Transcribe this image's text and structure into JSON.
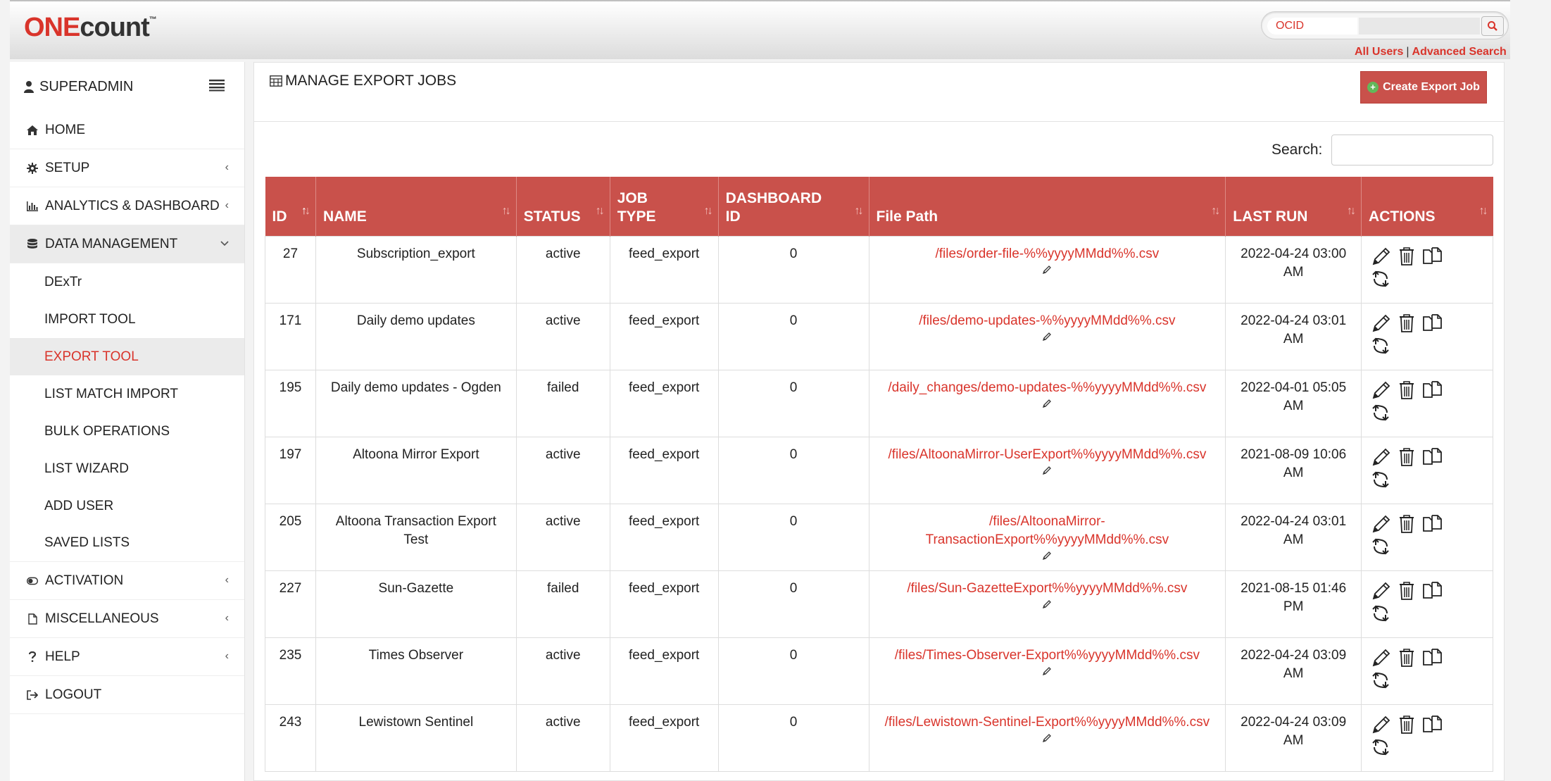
{
  "header": {
    "logo_one": "ONE",
    "logo_count": "count",
    "logo_tm": "™",
    "search_prefix": "OCID",
    "links": {
      "all_users": "All Users",
      "separator": "|",
      "advanced_search": "Advanced Search"
    }
  },
  "sidebar": {
    "user": "SUPERADMIN",
    "items": [
      {
        "label": "HOME",
        "icon": "home-icon"
      },
      {
        "label": "SETUP",
        "icon": "gear-icon"
      },
      {
        "label": "ANALYTICS & DASHBOARD",
        "icon": "bar-chart-icon"
      },
      {
        "label": "DATA MANAGEMENT",
        "icon": "database-icon"
      },
      {
        "label": "ACTIVATION",
        "icon": "toggle-icon"
      },
      {
        "label": "MISCELLANEOUS",
        "icon": "file-icon"
      },
      {
        "label": "HELP",
        "icon": "question-icon"
      },
      {
        "label": "LOGOUT",
        "icon": "logout-icon"
      }
    ],
    "sub_items": [
      {
        "label": "DExTr"
      },
      {
        "label": "IMPORT TOOL"
      },
      {
        "label": "EXPORT TOOL"
      },
      {
        "label": "LIST MATCH IMPORT"
      },
      {
        "label": "BULK OPERATIONS"
      },
      {
        "label": "LIST WIZARD"
      },
      {
        "label": "ADD USER"
      },
      {
        "label": "SAVED LISTS"
      }
    ],
    "collapse_chevron": "‹",
    "expand_chevron": "›"
  },
  "main": {
    "title": "MANAGE EXPORT JOBS",
    "create_button": "Create Export Job",
    "search_label": "Search:",
    "columns": [
      {
        "line1": "ID",
        "line2": ""
      },
      {
        "line1": "NAME",
        "line2": ""
      },
      {
        "line1": "STATUS",
        "line2": ""
      },
      {
        "line1": "JOB",
        "line2": "TYPE"
      },
      {
        "line1": "DASHBOARD",
        "line2": "ID"
      },
      {
        "line1": "File Path",
        "line2": ""
      },
      {
        "line1": "LAST RUN",
        "line2": ""
      },
      {
        "line1": "ACTIONS",
        "line2": ""
      }
    ],
    "rows": [
      {
        "id": "27",
        "name": "Subscription_export",
        "status": "active",
        "job_type": "feed_export",
        "dashboard_id": "0",
        "file_path": "/files/order-file-%%yyyyMMdd%%.csv",
        "last_run": "2022-04-24 03:00 AM"
      },
      {
        "id": "171",
        "name": "Daily demo updates",
        "status": "active",
        "job_type": "feed_export",
        "dashboard_id": "0",
        "file_path": "/files/demo-updates-%%yyyyMMdd%%.csv",
        "last_run": "2022-04-24 03:01 AM"
      },
      {
        "id": "195",
        "name": "Daily demo updates - Ogden",
        "status": "failed",
        "job_type": "feed_export",
        "dashboard_id": "0",
        "file_path": "/daily_changes/demo-updates-%%yyyyMMdd%%.csv",
        "last_run": "2022-04-01 05:05 AM"
      },
      {
        "id": "197",
        "name": "Altoona Mirror Export",
        "status": "active",
        "job_type": "feed_export",
        "dashboard_id": "0",
        "file_path": "/files/AltoonaMirror-UserExport%%yyyyMMdd%%.csv",
        "last_run": "2021-08-09 10:06 AM"
      },
      {
        "id": "205",
        "name": "Altoona Transaction Export Test",
        "status": "active",
        "job_type": "feed_export",
        "dashboard_id": "0",
        "file_path": "/files/AltoonaMirror-TransactionExport%%yyyyMMdd%%.csv",
        "last_run": "2022-04-24 03:01 AM"
      },
      {
        "id": "227",
        "name": "Sun-Gazette",
        "status": "failed",
        "job_type": "feed_export",
        "dashboard_id": "0",
        "file_path": "/files/Sun-GazetteExport%%yyyyMMdd%%.csv",
        "last_run": "2021-08-15 01:46 PM"
      },
      {
        "id": "235",
        "name": "Times Observer",
        "status": "active",
        "job_type": "feed_export",
        "dashboard_id": "0",
        "file_path": "/files/Times-Observer-Export%%yyyyMMdd%%.csv",
        "last_run": "2022-04-24 03:09 AM"
      },
      {
        "id": "243",
        "name": "Lewistown Sentinel",
        "status": "active",
        "job_type": "feed_export",
        "dashboard_id": "0",
        "file_path": "/files/Lewistown-Sentinel-Export%%yyyyMMdd%%.csv",
        "last_run": "2022-04-24 03:09 AM"
      }
    ],
    "row_actions": [
      "edit-icon",
      "trash-icon",
      "copy-icon",
      "sync-icon"
    ]
  },
  "colors": {
    "accent": "#d9342b",
    "table_header": "#c9514b",
    "active_bg": "#ebebeb"
  }
}
